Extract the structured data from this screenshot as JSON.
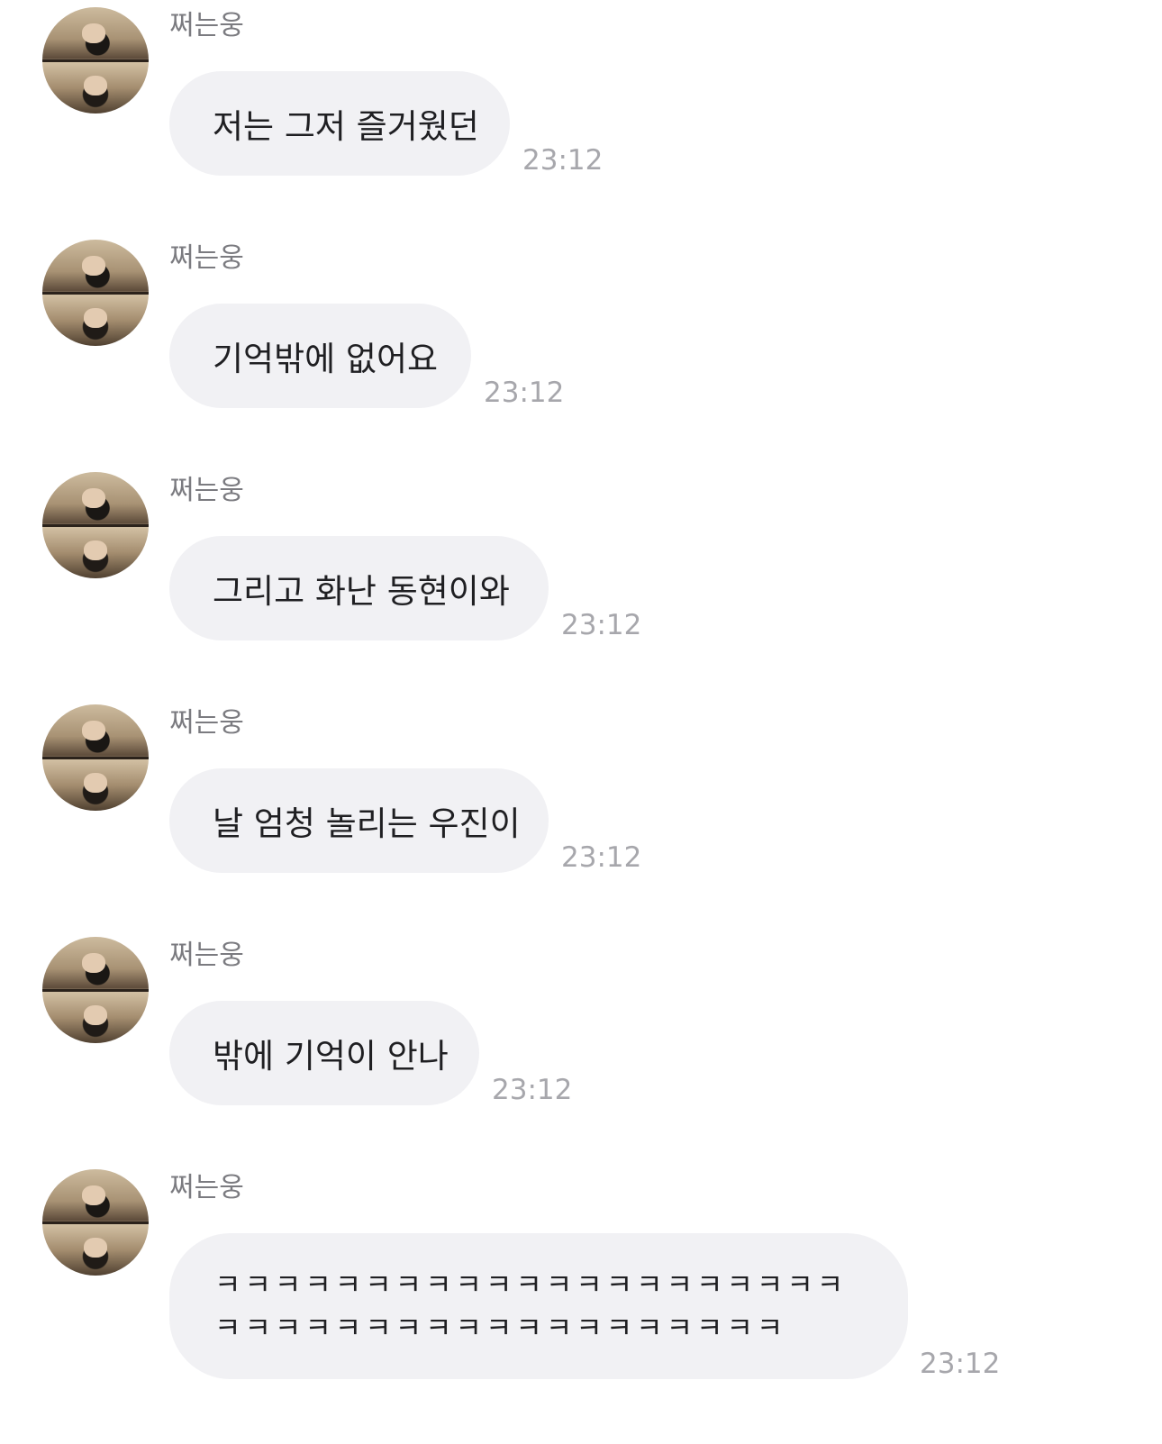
{
  "messages": [
    {
      "sender": "쩌는웅",
      "text": "저는 그저 즐거웠던",
      "time": "23:12"
    },
    {
      "sender": "쩌는웅",
      "text": "기억밖에 없어요",
      "time": "23:12"
    },
    {
      "sender": "쩌는웅",
      "text": "그리고 화난 동현이와",
      "time": "23:12"
    },
    {
      "sender": "쩌는웅",
      "text": "날 엄청 놀리는 우진이",
      "time": "23:12"
    },
    {
      "sender": "쩌는웅",
      "text": "밖에 기억이 안나",
      "time": "23:12"
    },
    {
      "sender": "쩌는웅",
      "text": "ㅋㅋㅋㅋㅋㅋㅋㅋㅋㅋㅋㅋㅋㅋㅋㅋㅋㅋㅋㅋㅋㅋㅋㅋㅋㅋㅋㅋㅋㅋㅋㅋㅋㅋㅋㅋㅋㅋㅋㅋ",
      "time": "23:12"
    }
  ],
  "colors": {
    "bubble": "#f1f1f4",
    "sender": "#7b7b80",
    "time": "#a7a7ac",
    "text": "#1f1f22"
  }
}
